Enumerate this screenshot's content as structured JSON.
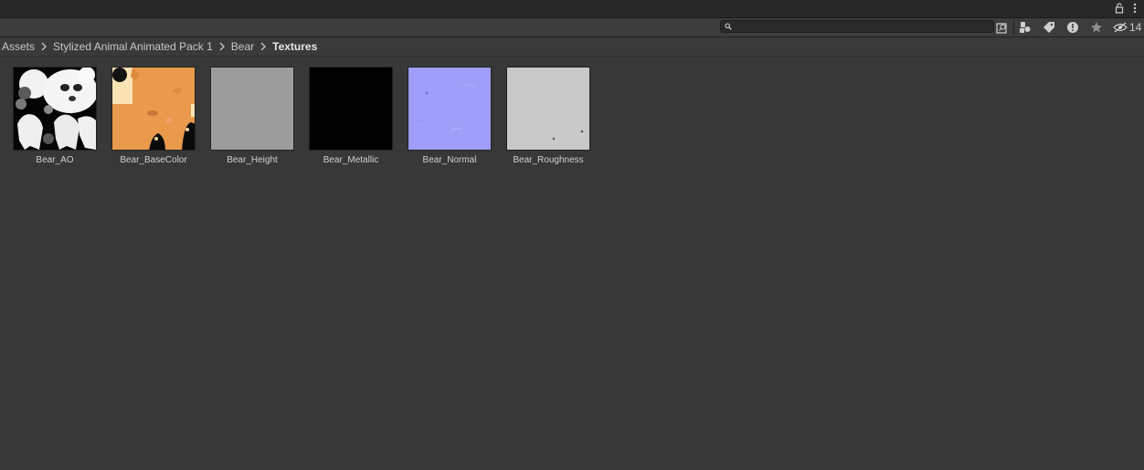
{
  "toolbar": {
    "search_value": "",
    "hidden_count": "14",
    "icons": [
      "lock-icon",
      "kebab-menu-icon",
      "search-icon",
      "search-by-type-icon",
      "scene-filter-icon",
      "label-filter-icon",
      "warning-filter-icon",
      "favorite-star-icon",
      "hidden-eye-icon"
    ]
  },
  "breadcrumb": {
    "items": [
      "Assets",
      "Stylized Animal Animated Pack 1",
      "Bear",
      "Textures"
    ]
  },
  "assets": [
    {
      "name": "Bear_AO",
      "thumb": "ao"
    },
    {
      "name": "Bear_BaseColor",
      "thumb": "basecolor"
    },
    {
      "name": "Bear_Height",
      "thumb": "height"
    },
    {
      "name": "Bear_Metallic",
      "thumb": "metallic"
    },
    {
      "name": "Bear_Normal",
      "thumb": "normal"
    },
    {
      "name": "Bear_Roughness",
      "thumb": "roughness"
    }
  ],
  "colors": {
    "background": "#383838",
    "height_gray": "#9c9c9c",
    "metallic_black": "#000000",
    "normal_blue": "#9f9ffa",
    "roughness_gray": "#c9c9c9",
    "basecolor_orange": "#e99a4c"
  }
}
